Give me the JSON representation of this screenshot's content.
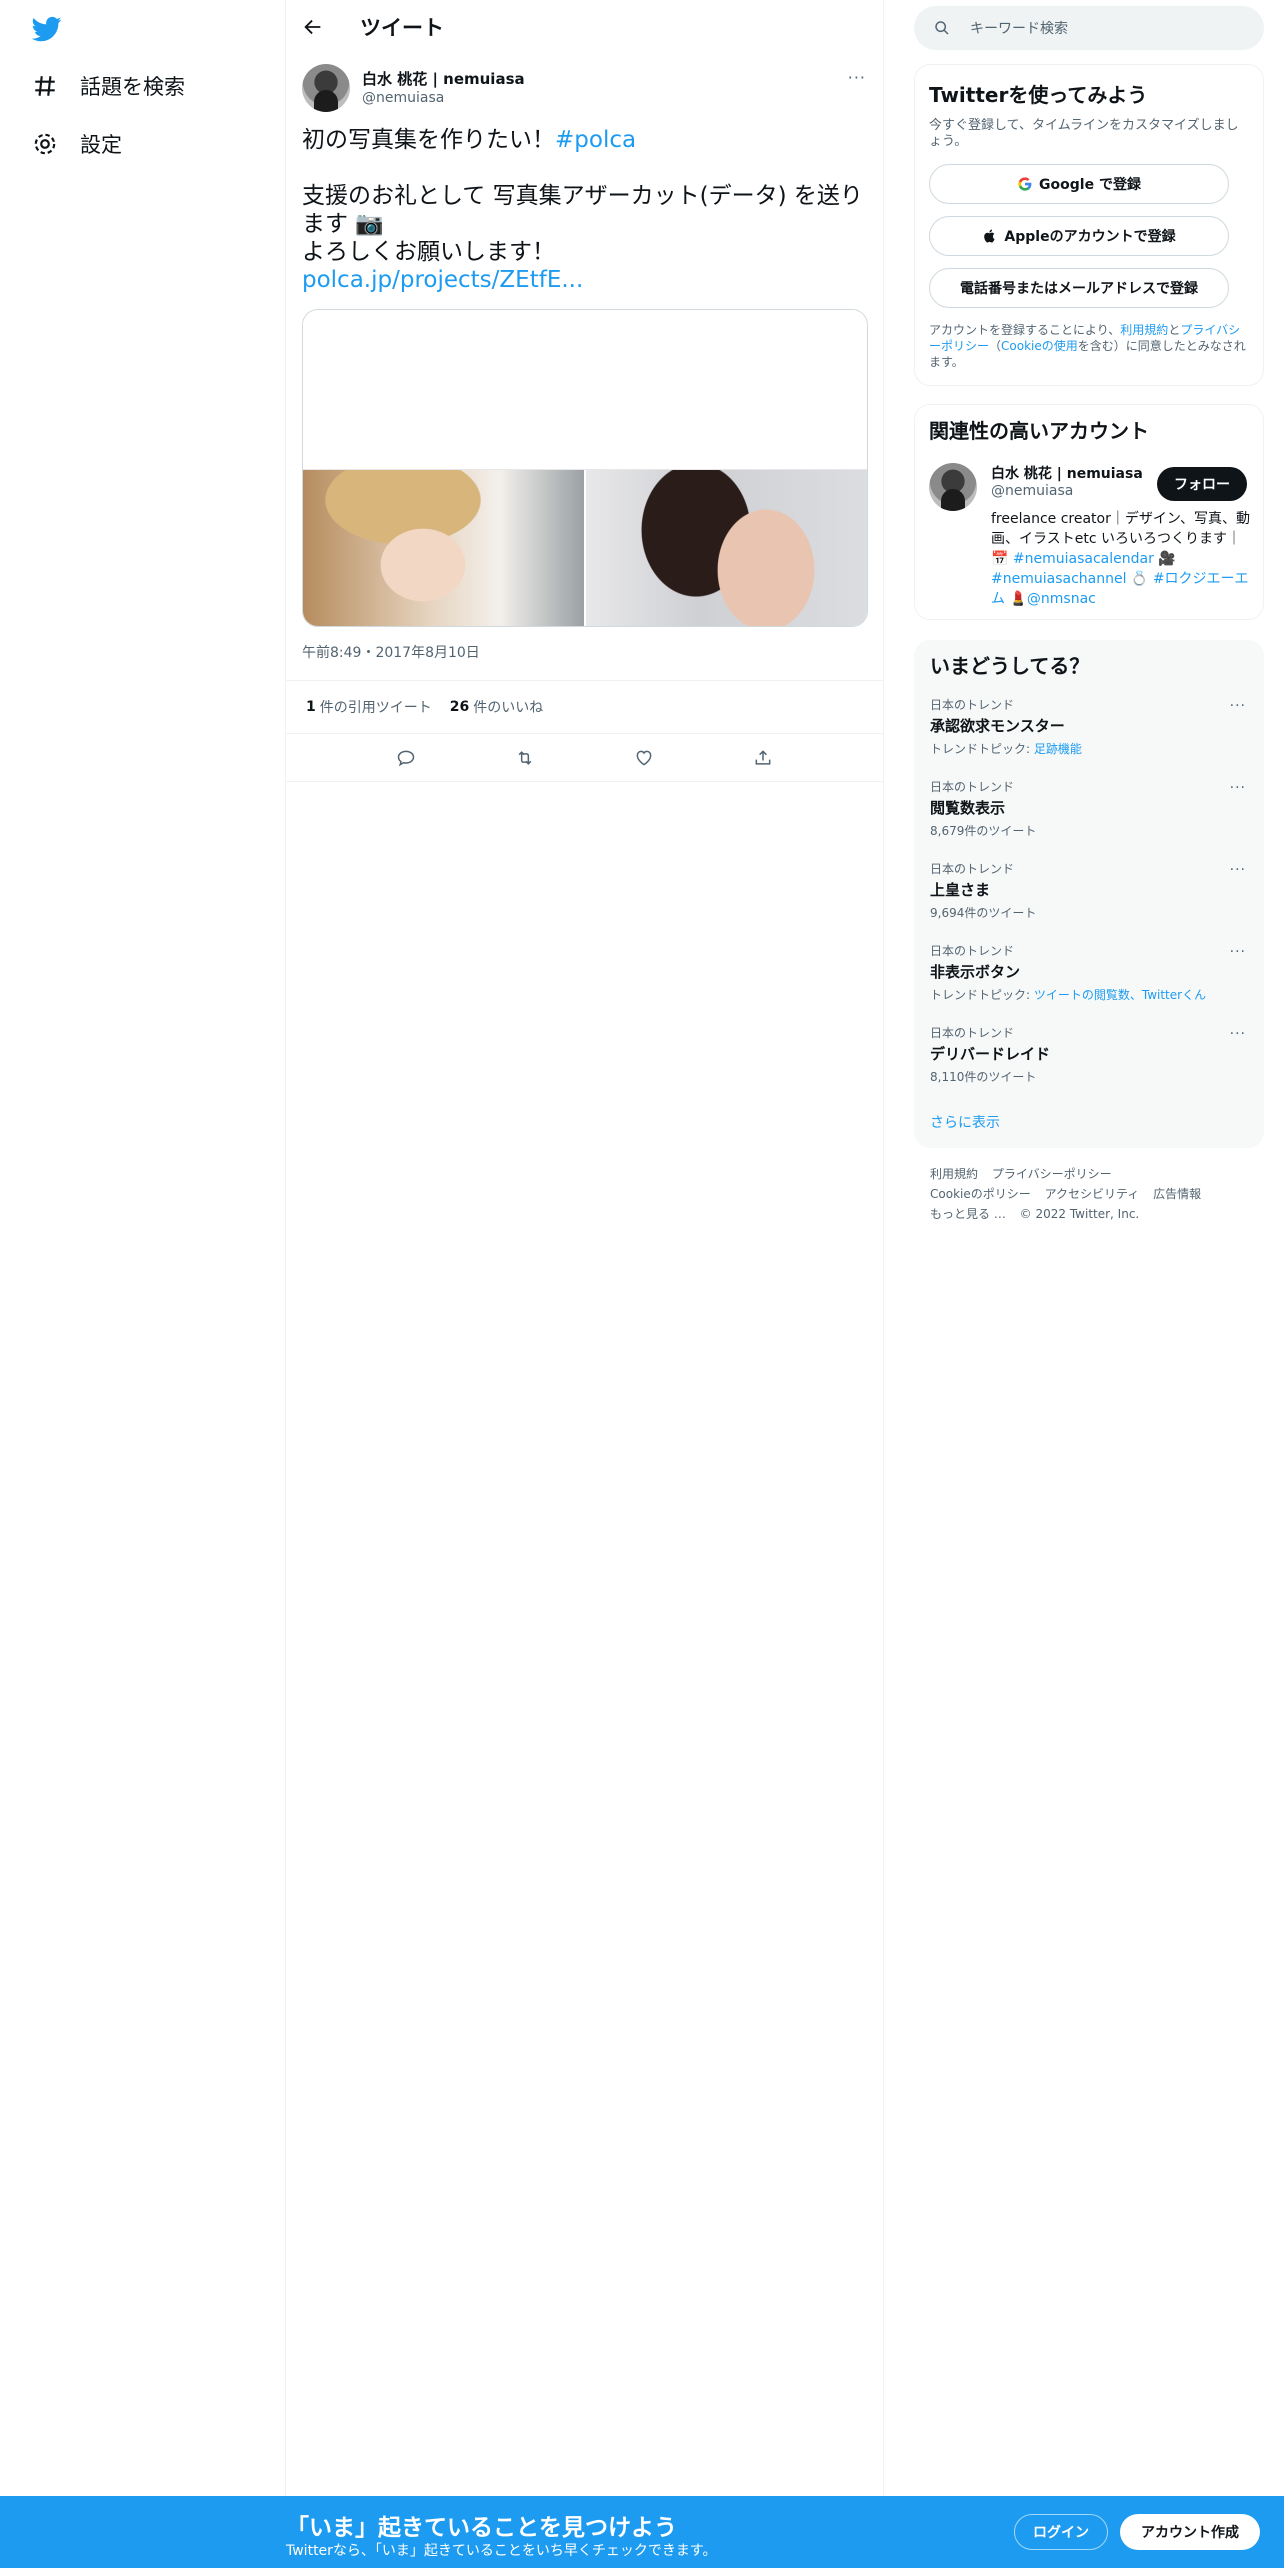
{
  "nav": {
    "items": [
      {
        "label": "話題を検索",
        "icon": "hashtag-icon"
      },
      {
        "label": "設定",
        "icon": "gear-icon"
      }
    ]
  },
  "header": {
    "title": "ツイート"
  },
  "tweet": {
    "author_name": "白水 桃花 | nemuiasa",
    "author_handle": "@nemuiasa",
    "text_line1": "初の写真集を作りたい！",
    "hashtag": "#polca",
    "text_line2": "支援のお礼として 写真集アザーカット(データ) を送ります 📷",
    "text_line3": "よろしくお願いします！",
    "link": "polca.jp/projects/ZEtfE...",
    "timestamp": "午前8:49・2017年8月10日",
    "quote_count": "1",
    "quote_label": "件の引用ツイート",
    "like_count": "26",
    "like_label": "件のいいね"
  },
  "search": {
    "placeholder": "キーワード検索"
  },
  "signup_card": {
    "title": "Twitterを使ってみよう",
    "subtitle": "今すぐ登録して、タイムラインをカスタマイズしましょう。",
    "google_label": "Google で登録",
    "apple_label": "Appleのアカウントで登録",
    "phone_label": "電話番号またはメールアドレスで登録",
    "legal_prefix": "アカウントを登録することにより、",
    "legal_terms": "利用規約",
    "legal_and": "と",
    "legal_privacy": "プライバシーポリシー",
    "legal_open": "（",
    "legal_cookie": "Cookieの使用",
    "legal_suffix": "を含む）に同意したとみなされます。"
  },
  "related": {
    "title": "関連性の高いアカウント",
    "name": "白水 桃花 | nemuiasa",
    "handle": "@nemuiasa",
    "follow_label": "フォロー",
    "bio_text": "freelance creator｜デザイン、写真、動画、イラストetc いろいろつくります｜📅 ",
    "bio_tag1": "#nemuiasacalendar",
    "bio_mid1": " 🎥 ",
    "bio_tag2": "#nemuiasachannel",
    "bio_mid2": " 💍 ",
    "bio_tag3": "#ロクジエーエム",
    "bio_mid3": " 💄",
    "bio_mention": "@nmsnac"
  },
  "trends": {
    "title": "いまどうしてる？",
    "items": [
      {
        "context": "日本のトレンド",
        "name": "承認欲求モンスター",
        "meta_prefix": "トレンドトピック: ",
        "meta_link": "足跡機能"
      },
      {
        "context": "日本のトレンド",
        "name": "閲覧数表示",
        "meta": "8,679件のツイート"
      },
      {
        "context": "日本のトレンド",
        "name": "上皇さま",
        "meta": "9,694件のツイート"
      },
      {
        "context": "日本のトレンド",
        "name": "非表示ボタン",
        "meta_prefix": "トレンドトピック: ",
        "meta_link": "ツイートの閲覧数、Twitterくん"
      },
      {
        "context": "日本のトレンド",
        "name": "デリバードレイド",
        "meta": "8,110件のツイート"
      }
    ],
    "show_more": "さらに表示"
  },
  "footer": {
    "links": [
      "利用規約",
      "プライバシーポリシー",
      "Cookieのポリシー",
      "アクセシビリティ",
      "広告情報",
      "もっと見る …"
    ],
    "copyright": "© 2022 Twitter, Inc."
  },
  "banner": {
    "title": "「いま」起きていることを見つけよう",
    "subtitle": "Twitterなら、「いま」起きていることをいち早くチェックできます。",
    "login": "ログイン",
    "signup": "アカウント作成"
  },
  "colors": {
    "accent": "#1d9bf0",
    "text": "#0f1419",
    "muted": "#536471",
    "banner": "#1d9bf0"
  }
}
